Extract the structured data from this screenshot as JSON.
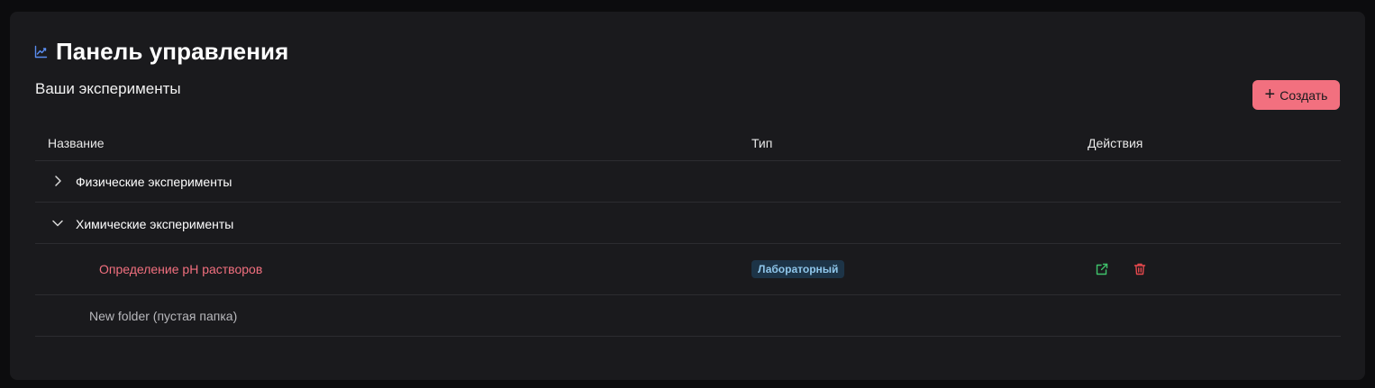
{
  "header": {
    "title": "Панель управления",
    "icon": "chart-line-icon"
  },
  "section": {
    "subtitle": "Ваши эксперименты",
    "create_label": "Создать"
  },
  "table": {
    "columns": [
      "Название",
      "Тип",
      "Действия"
    ],
    "folders": [
      {
        "label": "Физические эксперименты",
        "expanded": false
      },
      {
        "label": "Химические эксперименты",
        "expanded": true
      }
    ],
    "items": [
      {
        "name": "Определение pH растворов",
        "type": "Лабораторный",
        "actions": [
          "open-external-icon",
          "trash-icon"
        ]
      }
    ],
    "empty_folder": "New folder (пустая папка)"
  },
  "colors": {
    "accent": "#f2707f",
    "badge_bg": "#1d3447",
    "badge_text": "#8fc6ea",
    "open_icon": "#3fc26b",
    "delete_icon": "#e5484d",
    "chart_icon": "#5a8df0"
  }
}
